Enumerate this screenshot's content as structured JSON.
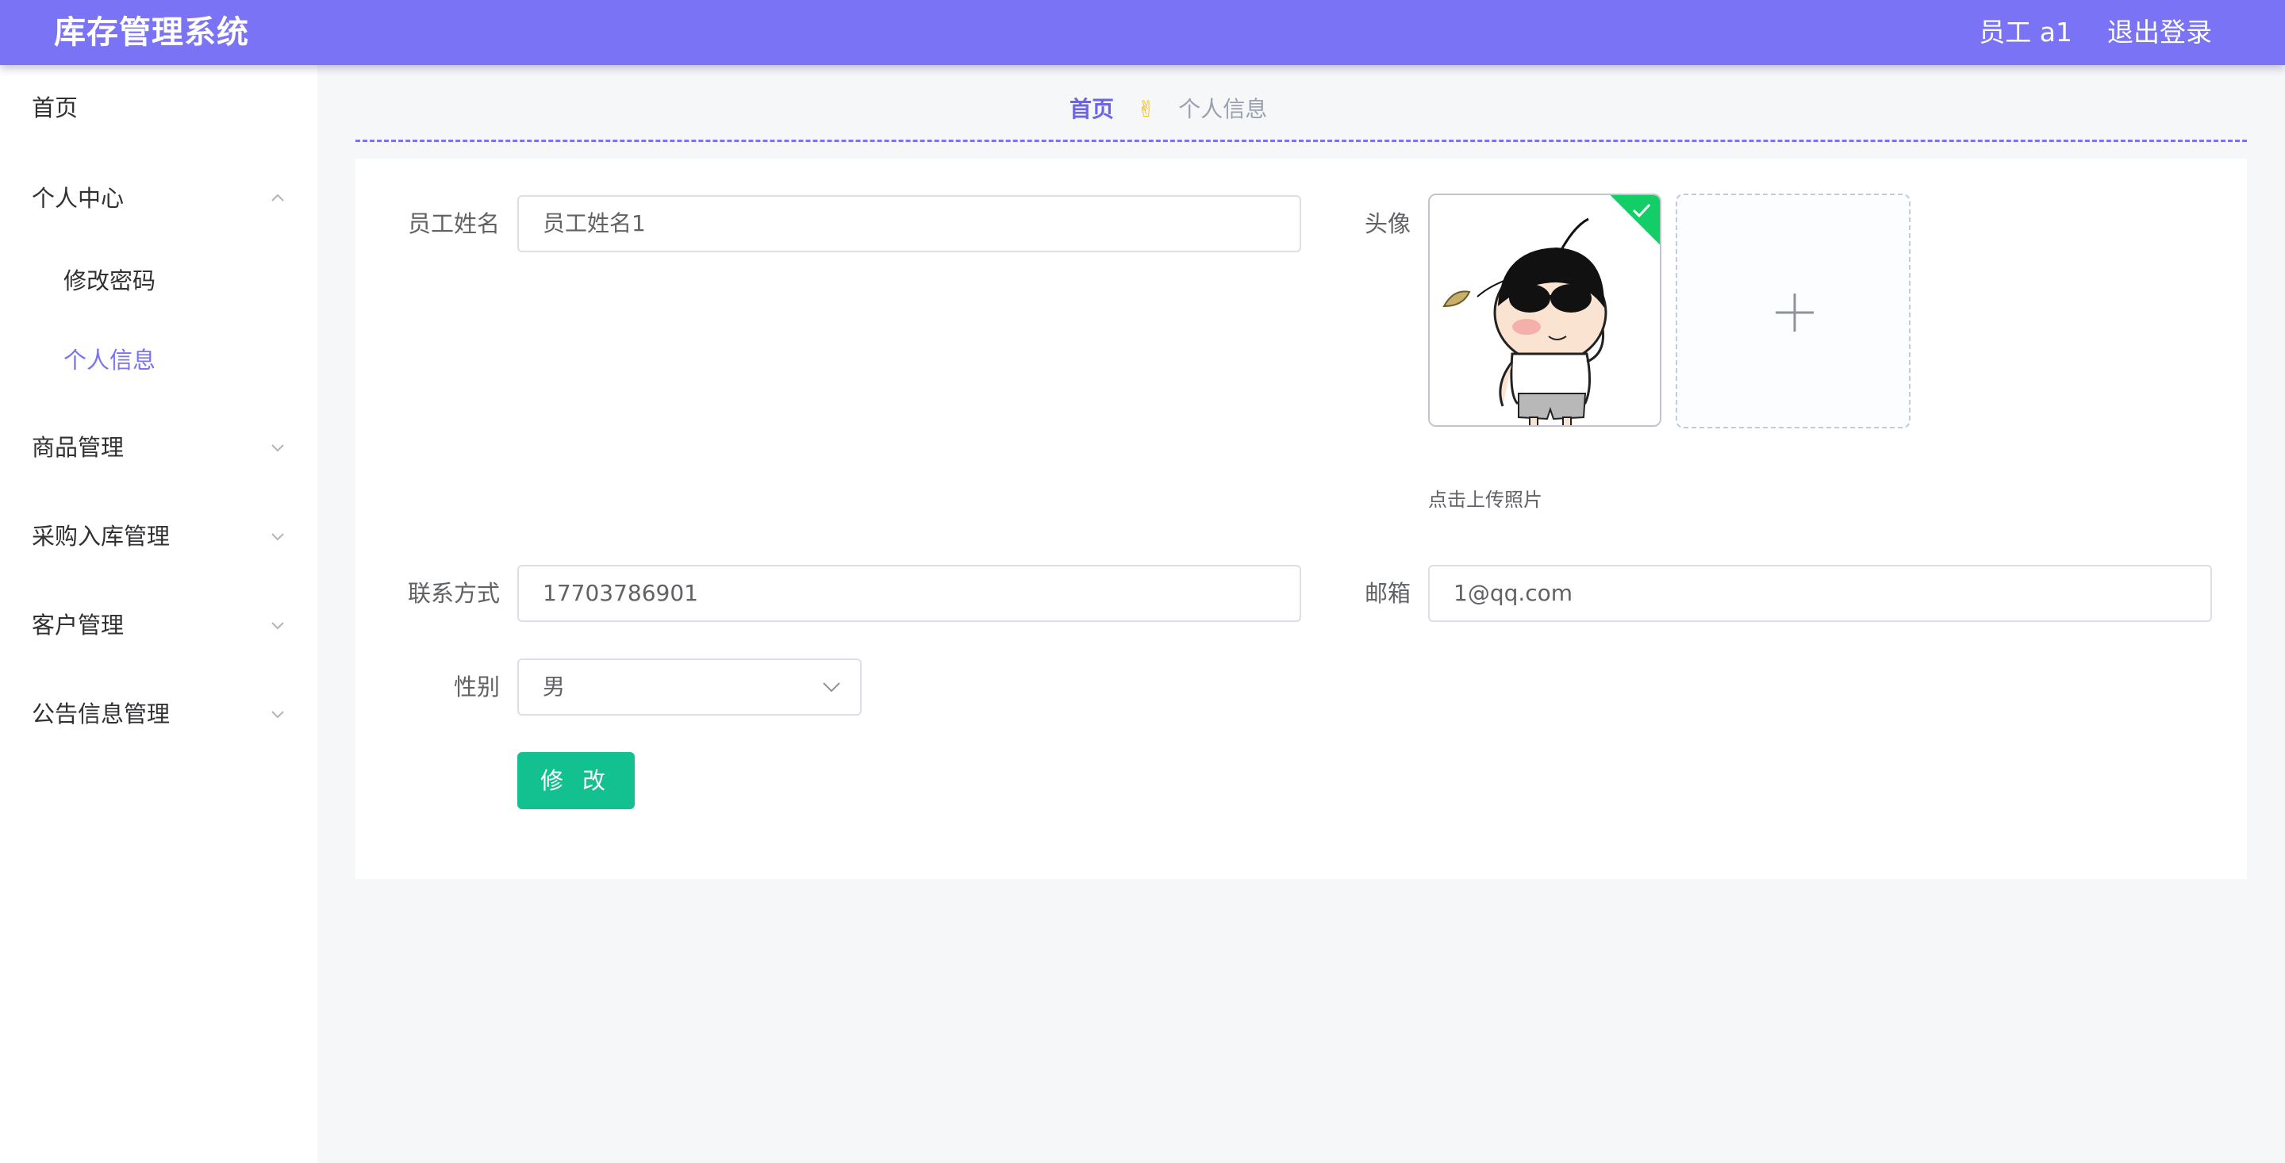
{
  "header": {
    "app_title": "库存管理系统",
    "user_label": "员工 a1",
    "logout_label": "退出登录"
  },
  "sidebar": {
    "items": [
      {
        "label": "首页"
      },
      {
        "label": "个人中心",
        "expanded": true,
        "children": [
          {
            "label": "修改密码"
          },
          {
            "label": "个人信息",
            "active": true
          }
        ]
      },
      {
        "label": "商品管理"
      },
      {
        "label": "采购入库管理"
      },
      {
        "label": "客户管理"
      },
      {
        "label": "公告信息管理"
      }
    ]
  },
  "breadcrumb": {
    "home": "首页",
    "separator": "✌",
    "current": "个人信息"
  },
  "form": {
    "name_label": "员工姓名",
    "name_value": "员工姓名1",
    "avatar_label": "头像",
    "upload_tip": "点击上传照片",
    "phone_label": "联系方式",
    "phone_value": "17703786901",
    "email_label": "邮箱",
    "email_value": "1@qq.com",
    "gender_label": "性别",
    "gender_value": "男",
    "submit_label": "修 改"
  },
  "colors": {
    "accent": "#7b73f5",
    "success": "#13c08f"
  }
}
